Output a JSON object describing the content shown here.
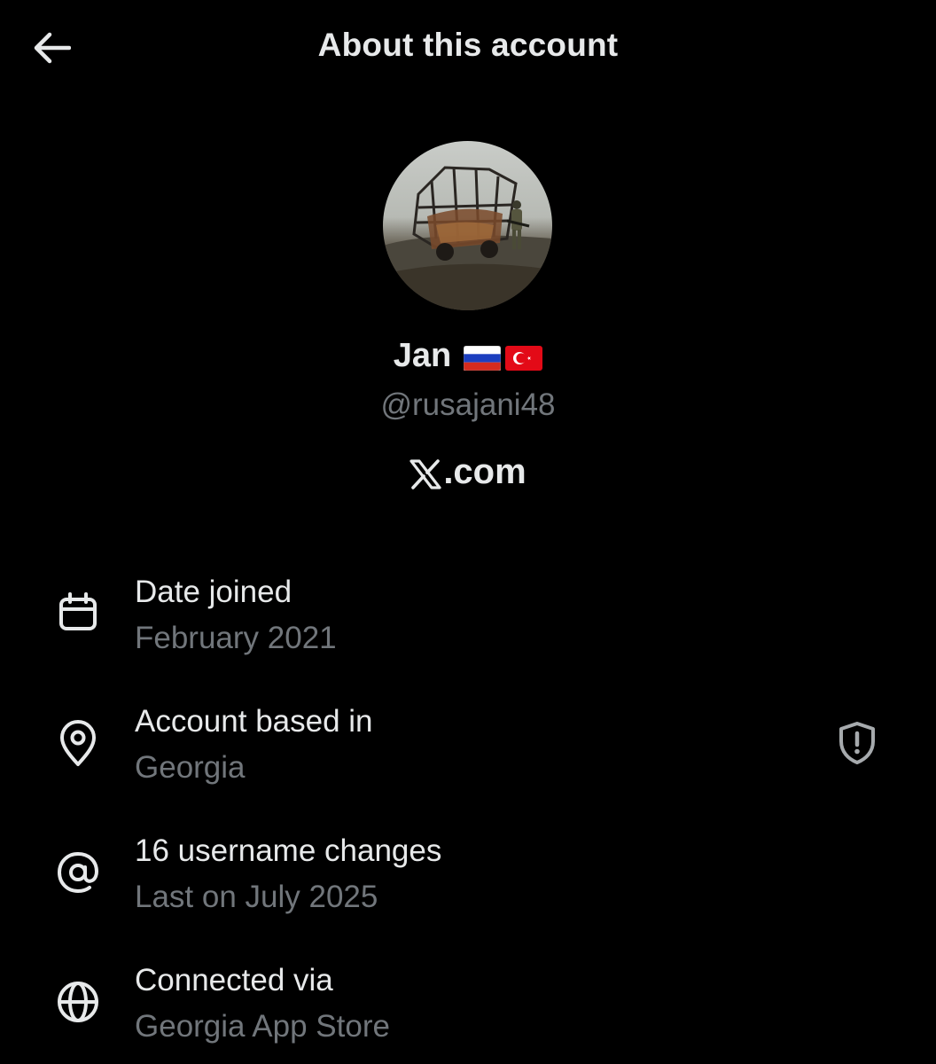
{
  "header": {
    "title": "About this account",
    "back_icon": "arrow-left-icon"
  },
  "profile": {
    "display_name": "Jan",
    "flags": [
      "russia-flag-icon",
      "turkey-flag-icon"
    ],
    "username": "@rusajani48",
    "platform": ".com",
    "platform_logo": "x-logo-icon"
  },
  "details": [
    {
      "icon": "calendar-icon",
      "label": "Date joined",
      "value": "February 2021"
    },
    {
      "icon": "location-pin-icon",
      "label": "Account based in",
      "value": "Georgia",
      "trailing_icon": "shield-alert-icon"
    },
    {
      "icon": "at-sign-icon",
      "label": "16 username changes",
      "value": "Last on July 2025"
    },
    {
      "icon": "globe-icon",
      "label": "Connected via",
      "value": "Georgia App Store"
    }
  ],
  "colors": {
    "background": "#000000",
    "primary_text": "#e7e9ea",
    "secondary_text": "#71767b"
  }
}
